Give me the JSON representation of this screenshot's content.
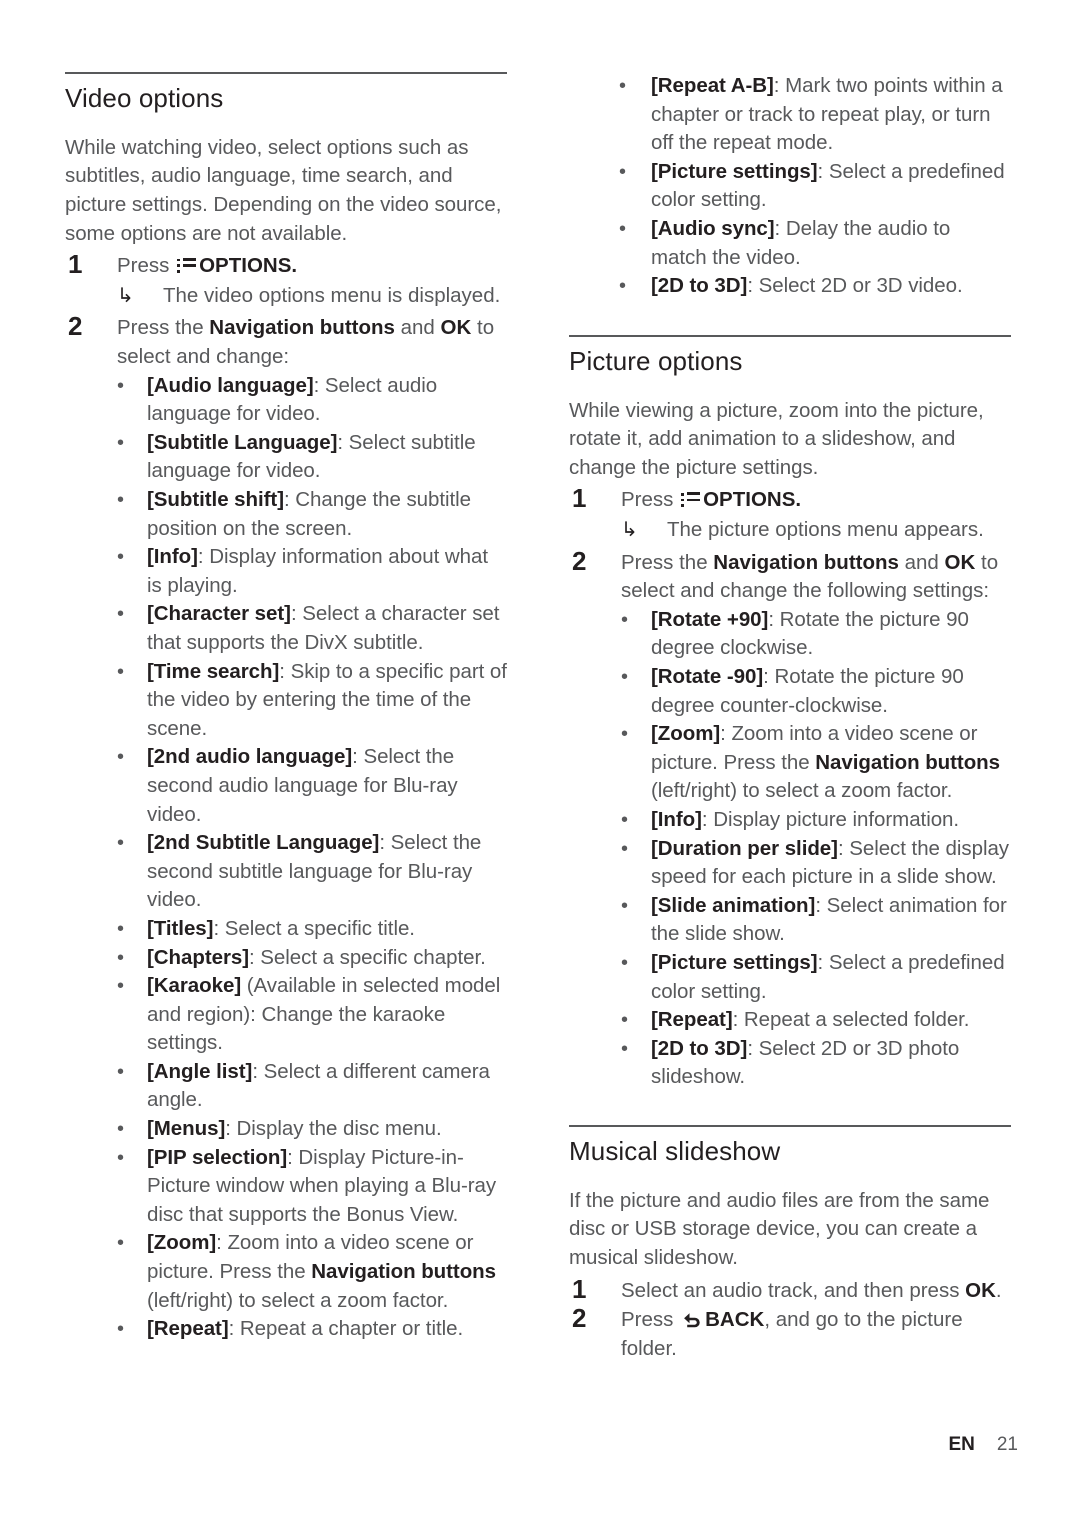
{
  "page": {
    "language_code": "EN",
    "page_number": "21"
  },
  "icons": {
    "options": "options-menu-icon",
    "back": "back-arrow-icon",
    "result_arrow": "↳",
    "bullet": "•"
  },
  "colors": {
    "heading": "#231f20",
    "body": "#58595b",
    "rule": "#58595b",
    "background": "#ffffff"
  },
  "left_column": {
    "sections": [
      {
        "heading": "Video options",
        "intro": "While watching video, select options such as subtitles, audio language, time search, and picture settings. Depending on the video source, some options are not available.",
        "steps": [
          {
            "number": "1",
            "text_before_icon": "Press ",
            "icon": "options",
            "text_after_icon": "OPTIONS.",
            "result": "The video options menu is displayed."
          },
          {
            "number": "2",
            "text_parts": [
              {
                "text": "Press the ",
                "bold": false
              },
              {
                "text": "Navigation buttons",
                "bold": true
              },
              {
                "text": " and ",
                "bold": false
              },
              {
                "text": "OK",
                "bold": true
              },
              {
                "text": " to select and change:",
                "bold": false
              }
            ],
            "bullets": [
              {
                "term": "[Audio language]",
                "desc": ": Select audio language for video."
              },
              {
                "term": "[Subtitle Language]",
                "desc": ": Select subtitle language for video."
              },
              {
                "term": "[Subtitle shift]",
                "desc": ": Change the subtitle position on the screen."
              },
              {
                "term": "[Info]",
                "desc": ": Display information about what is playing."
              },
              {
                "term": "[Character set]",
                "desc": ": Select a character set that supports the DivX subtitle."
              },
              {
                "term": "[Time search]",
                "desc": ": Skip to a specific part of the video by entering the time of the scene."
              },
              {
                "term": "[2nd audio language]",
                "desc": ": Select the second audio language for Blu-ray video."
              },
              {
                "term": "[2nd Subtitle Language]",
                "desc": ": Select the second subtitle language for Blu-ray video."
              },
              {
                "term": "[Titles]",
                "desc": ": Select a specific title."
              },
              {
                "term": "[Chapters]",
                "desc": ": Select a specific chapter."
              },
              {
                "term": "[Karaoke]",
                "desc": " (Available in selected model and region): Change the karaoke settings."
              },
              {
                "term": "[Angle list]",
                "desc": ": Select a different camera angle."
              },
              {
                "term": "[Menus]",
                "desc": ": Display the disc menu."
              },
              {
                "term": "[PIP selection]",
                "desc": ": Display Picture-in-Picture window when playing a Blu-ray disc that supports the Bonus View."
              },
              {
                "term": "[Zoom]",
                "desc": ": Zoom into a video scene or picture. Press the ",
                "desc_bold": "Navigation buttons",
                "desc_tail": " (left/right) to select a zoom factor."
              },
              {
                "term": "[Repeat]",
                "desc": ": Repeat a chapter or title."
              }
            ]
          }
        ]
      }
    ]
  },
  "right_column": {
    "continued_bullets": [
      {
        "term": "[Repeat A-B]",
        "desc": ": Mark two points within a chapter or track to repeat play, or turn off the repeat mode."
      },
      {
        "term": "[Picture settings]",
        "desc": ": Select a predefined color setting."
      },
      {
        "term": "[Audio sync]",
        "desc": ": Delay the audio to match the video."
      },
      {
        "term": "[2D to 3D]",
        "desc": ": Select 2D or 3D video."
      }
    ],
    "sections": [
      {
        "heading": "Picture options",
        "intro": "While viewing a picture, zoom into the picture, rotate it, add animation to a slideshow, and change the picture settings.",
        "steps": [
          {
            "number": "1",
            "text_before_icon": "Press ",
            "icon": "options",
            "text_after_icon": "OPTIONS.",
            "result": "The picture options menu appears."
          },
          {
            "number": "2",
            "text_parts": [
              {
                "text": "Press the ",
                "bold": false
              },
              {
                "text": "Navigation buttons",
                "bold": true
              },
              {
                "text": " and ",
                "bold": false
              },
              {
                "text": "OK",
                "bold": true
              },
              {
                "text": " to select and change the following settings:",
                "bold": false
              }
            ],
            "bullets": [
              {
                "term": "[Rotate +90]",
                "desc": ": Rotate the picture 90 degree clockwise."
              },
              {
                "term": "[Rotate -90]",
                "desc": ": Rotate the picture 90 degree counter-clockwise."
              },
              {
                "term": "[Zoom]",
                "desc": ": Zoom into a video scene or picture. Press the ",
                "desc_bold": "Navigation buttons",
                "desc_tail": " (left/right) to select a zoom factor."
              },
              {
                "term": "[Info]",
                "desc": ": Display picture information."
              },
              {
                "term": "[Duration per slide]",
                "desc": ": Select the display speed for each picture in a slide show."
              },
              {
                "term": "[Slide animation]",
                "desc": ": Select animation for the slide show."
              },
              {
                "term": "[Picture settings]",
                "desc": ": Select a predefined color setting."
              },
              {
                "term": "[Repeat]",
                "desc": ": Repeat a selected folder."
              },
              {
                "term": "[2D to 3D]",
                "desc": ": Select 2D or 3D photo slideshow."
              }
            ]
          }
        ]
      },
      {
        "heading": "Musical slideshow",
        "intro": "If the picture and audio files are from the same disc or USB storage device, you can create a musical slideshow.",
        "steps": [
          {
            "number": "1",
            "text_parts": [
              {
                "text": "Select an audio track, and then press ",
                "bold": false
              },
              {
                "text": "OK",
                "bold": true
              },
              {
                "text": ".",
                "bold": false
              }
            ]
          },
          {
            "number": "2",
            "text_before_icon": "Press ",
            "icon": "back",
            "text_after_icon_parts": [
              {
                "text": "BACK",
                "bold": true
              },
              {
                "text": ", and go to the picture folder.",
                "bold": false
              }
            ]
          }
        ]
      }
    ]
  }
}
